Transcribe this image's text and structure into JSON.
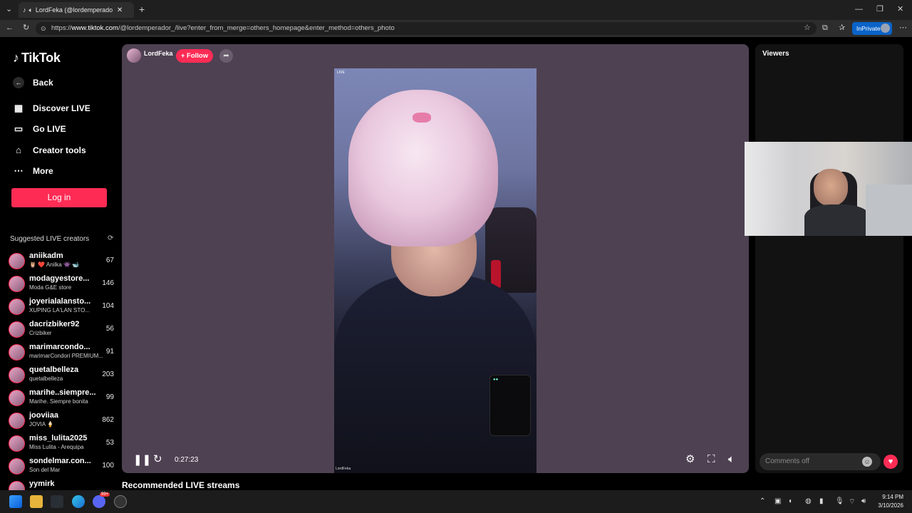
{
  "browser": {
    "tab_title": "LordFeka (@lordemperador_)",
    "new_tab": "+",
    "url_prefix": "https://",
    "url_domain": "www.tiktok.com",
    "url_path": "/@lordemperador_/live?enter_from_merge=others_homepage&enter_method=others_photo",
    "inprivate_label": "InPrivate",
    "window_controls": [
      "minimize-icon",
      "restore-icon",
      "close-icon"
    ]
  },
  "sidebar": {
    "logo": "TikTok",
    "back_label": "Back",
    "nav": [
      {
        "label": "Discover LIVE",
        "icon": "calendar-live-icon"
      },
      {
        "label": "Go LIVE",
        "icon": "video-camera-icon"
      },
      {
        "label": "Creator tools",
        "icon": "home-tools-icon"
      },
      {
        "label": "More",
        "icon": "ellipsis-icon"
      }
    ],
    "login_label": "Log in",
    "suggested_title": "Suggested LIVE creators",
    "creators": [
      {
        "name": "aniikadm",
        "sub": "🦉 ❤️ Anilka 👾 🐋",
        "count": "67"
      },
      {
        "name": "modagyestore...",
        "sub": "Moda G&E store",
        "count": "146"
      },
      {
        "name": "joyerialalansto...",
        "sub": "XUPING LA'LAN STO...",
        "count": "104"
      },
      {
        "name": "dacrizbiker92",
        "sub": "Crizbiker",
        "count": "56"
      },
      {
        "name": "marimarcondo...",
        "sub": "marimarCondori PREMIUM...",
        "count": "91"
      },
      {
        "name": "quetalbelleza",
        "sub": "quetalbelleza",
        "count": "203"
      },
      {
        "name": "marihe..siempre...",
        "sub": "Marihe. Siempre bonita",
        "count": "99"
      },
      {
        "name": "jooviiaa",
        "sub": "JOVIA 🍦",
        "count": "862"
      },
      {
        "name": "miss_lulita2025",
        "sub": "Miss Lulita - Arequipa",
        "count": "53"
      },
      {
        "name": "sondelmar.con...",
        "sub": "Son del Mar",
        "count": "100"
      },
      {
        "name": "yymirk",
        "sub": "",
        "count": ""
      }
    ]
  },
  "player": {
    "host_name": "LordFeka",
    "follow_label": "+ Follow",
    "live_badge": "LIVE",
    "watermark": "LordFeka",
    "time": "0:27:23"
  },
  "right_panel": {
    "viewers_title": "Viewers",
    "comments_placeholder": "Comments off"
  },
  "recommended_title": "Recommended LIVE streams",
  "taskbar": {
    "time": "9:14 PM",
    "date": "3/10/2026",
    "notification_count": "99+"
  },
  "colors": {
    "accent": "#fe2c55",
    "player_bg": "#4e4152",
    "inprivate": "#0a63c8"
  }
}
